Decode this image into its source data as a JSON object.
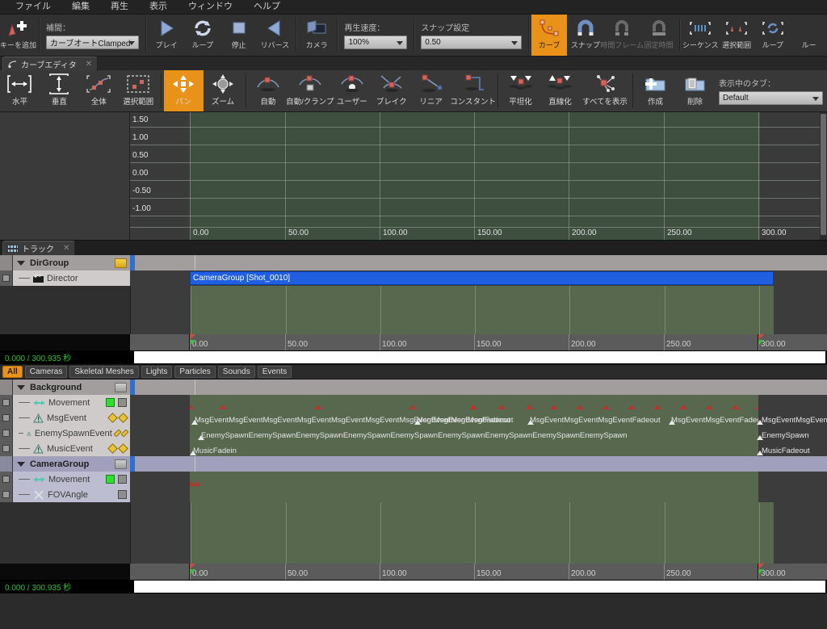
{
  "menu": {
    "items": [
      "ファイル",
      "編集",
      "再生",
      "表示",
      "ウィンドウ",
      "ヘルプ"
    ]
  },
  "toolbar": {
    "add_key": "キーを追加",
    "interp_caption": "補間：",
    "interp_value": "カーブオートClamped",
    "play": "プレイ",
    "loop": "ループ",
    "stop": "停止",
    "reverse": "リバース",
    "camera": "カメラ",
    "speed_caption": "再生速度：",
    "speed_value": "100%",
    "snap_caption": "スナップ設定",
    "snap_value": "0.50",
    "curve": "カーブ",
    "snap": "スナップ",
    "time_frame": "時間フレーム",
    "fixed_time": "固定時間",
    "sequence": "シーケンス",
    "selection": "選択範囲",
    "loop2": "ループ",
    "loop3": "ルー"
  },
  "curve_panel": {
    "tab_title": "カーブエディタ",
    "tab_close": "✕",
    "buttons": [
      "水平",
      "垂直",
      "全体",
      "選択範囲",
      "パン",
      "ズーム",
      "自動",
      "自動/クランプ",
      "ユーザー",
      "ブレイク",
      "リニア",
      "コンスタント",
      "平坦化",
      "直線化",
      "すべてを表示",
      "作成",
      "削除"
    ],
    "tab_select_caption": "表示中のタブ：",
    "tab_select_value": "Default"
  },
  "chart_data": {
    "type": "line",
    "title": "",
    "xlabel": "",
    "ylabel": "",
    "y_ticks": [
      "1.50",
      "1.00",
      "0.50",
      "0.00",
      "-0.50",
      "-1.00"
    ],
    "x_ticks": [
      "0.00",
      "50.00",
      "100.00",
      "150.00",
      "200.00",
      "250.00",
      "300.00"
    ],
    "xlim": [
      0,
      300
    ],
    "ylim": [
      -1.25,
      1.75
    ],
    "series": [],
    "grid": true,
    "legend": "none"
  },
  "track_panel": {
    "tab_title": "トラック",
    "tab_close": "✕"
  },
  "director": {
    "group_label": "DirGroup",
    "track_label": "Director",
    "shot_label": "CameraGroup [Shot_0010]"
  },
  "timeline": {
    "ticks": [
      "0.00",
      "50.00",
      "100.00",
      "150.00",
      "200.00",
      "250.00",
      "300.00"
    ],
    "status_top": "0.000 / 300.935 秒",
    "status_bottom": "0.000 / 300.935 秒"
  },
  "filters": {
    "items": [
      "All",
      "Cameras",
      "Skeletal Meshes",
      "Lights",
      "Particles",
      "Sounds",
      "Events"
    ],
    "active": "All"
  },
  "groups": [
    {
      "name": "Background",
      "type": "group",
      "folder": "gray",
      "tracks": [
        {
          "name": "Movement",
          "icon": "movement-icon",
          "chips": [
            "green",
            "gray"
          ],
          "lane": "green"
        },
        {
          "name": "MsgEvent",
          "icon": "event-icon",
          "chips": [
            "diamond",
            "diamond"
          ],
          "lane": "green"
        },
        {
          "name": "EnemySpawnEvent",
          "icon": "event-icon",
          "chips": [
            "diamond",
            "diamond"
          ],
          "lane": "green"
        },
        {
          "name": "MusicEvent",
          "icon": "event-icon",
          "chips": [
            "diamond",
            "diamond"
          ],
          "lane": "green"
        }
      ]
    },
    {
      "name": "CameraGroup",
      "type": "group",
      "folder": "gray",
      "tracks": [
        {
          "name": "Movement",
          "icon": "movement-icon",
          "chips": [
            "green",
            "gray"
          ],
          "lane": "green"
        },
        {
          "name": "FOVAngle",
          "icon": "fov-icon",
          "chips": [
            "gray"
          ],
          "lane": "green"
        }
      ]
    }
  ],
  "events": {
    "msg": [
      "MsgEventMsgEventMsgEventMsgEventMsgEventMsgEventMsgEventMsgEventMsgFadeout",
      "MsgEventMsgEventFadeout",
      "MsgEventMsgEventMsgEventFadeout",
      "MsgEventMsgEventFadeout"
    ],
    "msg_right": "MsgEventMsgEventFadeout",
    "spawn": "EnemySpawnEnemySpawnEnemySpawnEnemySpawnEnemySpawnEnemySpawnEnemySpawnEnemySpawnEnemySpawn",
    "spawn_right": "EnemySpawn",
    "music_left": "MusicFadein",
    "music_right": "MusicFadeout"
  }
}
